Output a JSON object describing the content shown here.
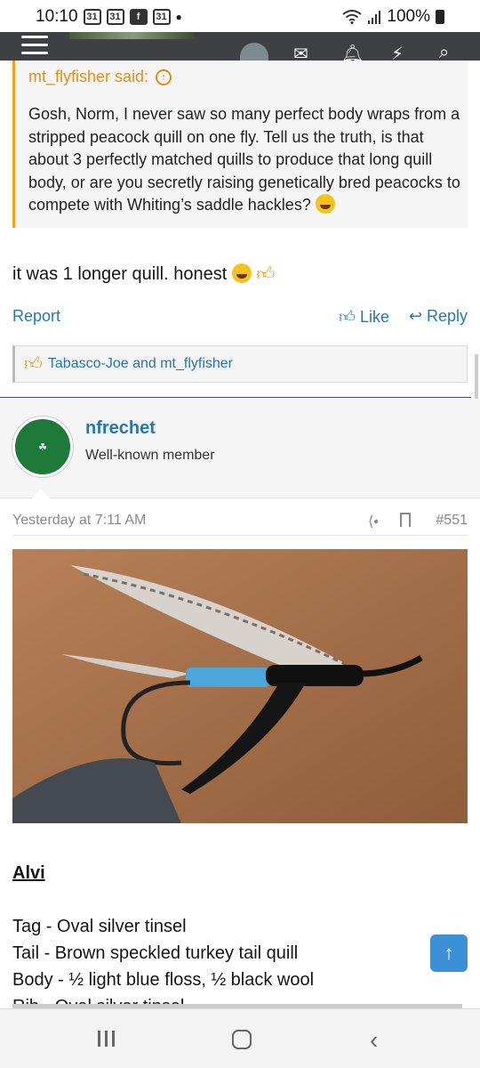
{
  "status": {
    "time": "10:10",
    "battery": "100%",
    "notifications": [
      "calendar-icon",
      "calendar-icon",
      "facebook-icon",
      "calendar-icon"
    ]
  },
  "quote": {
    "author": "mt_flyfisher said:",
    "text": "Gosh, Norm, I never saw so many perfect body wraps from a stripped peacock quill on one fly. Tell us the truth, is that about 3 perfectly matched quills to produce that long quill body, or are you secretly raising genetically bred peacocks to compete with Whiting’s saddle hackles?"
  },
  "reply": {
    "text": "it was 1 longer quill. honest"
  },
  "actions": {
    "report": "Report",
    "like": "Like",
    "reply": "Reply"
  },
  "reactions": {
    "text": "Tabasco-Joe and mt_flyfisher"
  },
  "post": {
    "username": "nfrechet",
    "user_title": "Well-known member",
    "timestamp": "Yesterday at 7:11 AM",
    "number": "#551",
    "fly_name": "Alvi",
    "lines": [
      "Tag - Oval silver tinsel",
      "Tail - Brown speckled turkey tail quill",
      "Body - ½ light blue floss, ½ black wool",
      "Rib - Oval silver tinsel"
    ]
  },
  "colors": {
    "link": "#2577b1",
    "quote_accent": "#f0a31a",
    "header": "#3f4043",
    "scroll_button": "#3d8fd6"
  }
}
